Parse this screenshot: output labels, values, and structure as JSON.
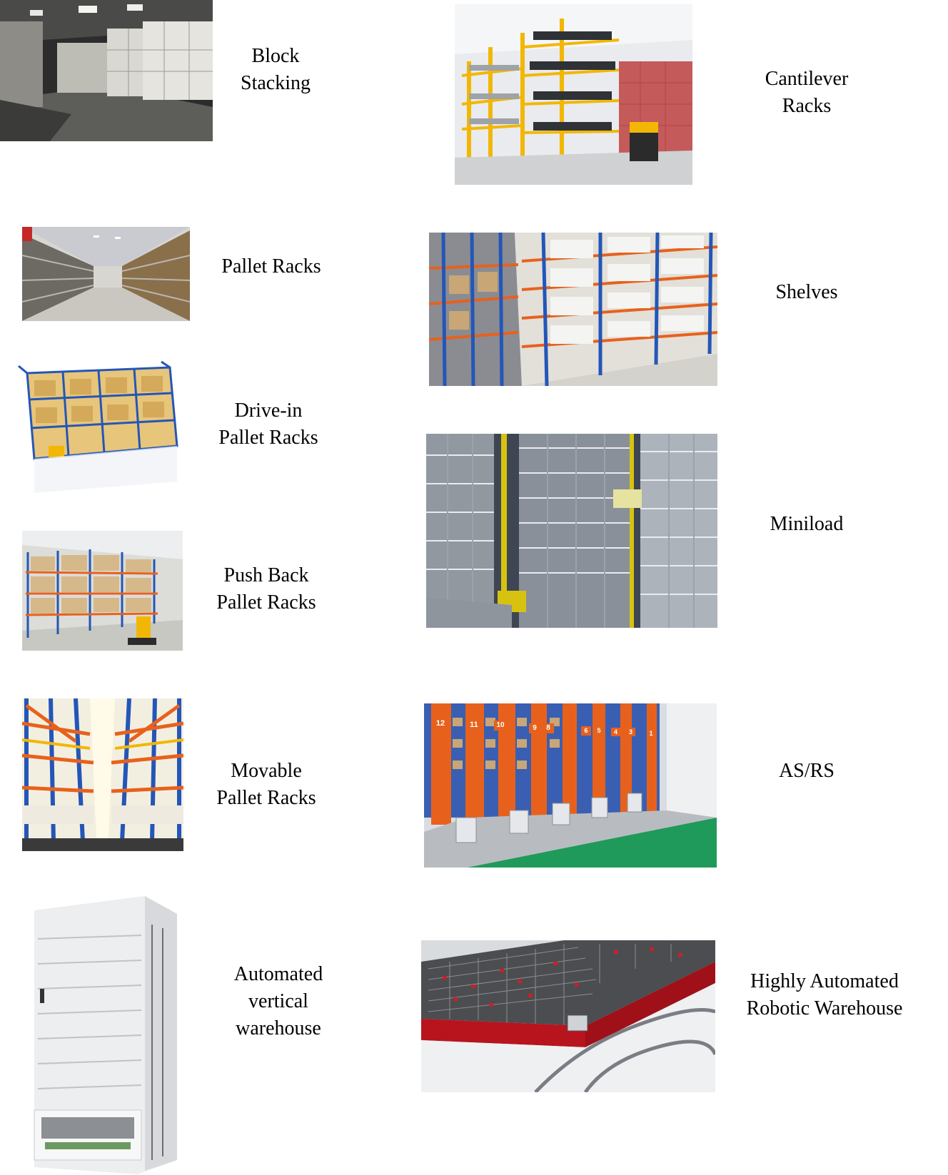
{
  "items": [
    {
      "id": "block-stacking",
      "label": "Block\nStacking"
    },
    {
      "id": "cantilever-racks",
      "label": "Cantilever\nRacks"
    },
    {
      "id": "pallet-racks",
      "label": "Pallet Racks"
    },
    {
      "id": "shelves",
      "label": "Shelves"
    },
    {
      "id": "drive-in-pallet-racks",
      "label": "Drive-in\nPallet Racks"
    },
    {
      "id": "miniload",
      "label": "Miniload"
    },
    {
      "id": "push-back-pallet-racks",
      "label": "Push Back\nPallet Racks"
    },
    {
      "id": "movable-pallet-racks",
      "label": "Movable\nPallet Racks"
    },
    {
      "id": "as-rs",
      "label": "AS/RS"
    },
    {
      "id": "automated-vertical-warehouse",
      "label": "Automated\nvertical\nwarehouse"
    },
    {
      "id": "highly-automated-robotic-warehouse",
      "label": "Highly Automated\nRobotic Warehouse"
    }
  ],
  "as_rs_aisle_numbers": [
    "12",
    "11",
    "10",
    "9",
    "8",
    "6",
    "5",
    "4",
    "3",
    "1"
  ],
  "colors": {
    "rack_blue": "#2456b8",
    "rack_orange": "#e8611c",
    "rack_yellow": "#f2b705",
    "floor_green": "#1f9a5a",
    "robot_red": "#c8202a",
    "warehouse_dark": "#3a3a3a"
  }
}
